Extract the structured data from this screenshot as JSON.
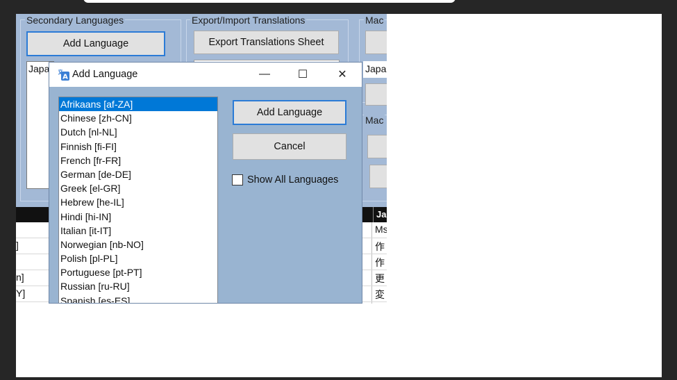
{
  "app": {
    "secondary_languages": {
      "label": "Secondary Languages",
      "add_button": "Add Language",
      "list_partial": "Japa"
    },
    "export_import": {
      "label": "Export/Import Translations",
      "export_button": "Export Translations Sheet"
    },
    "machine_group_1": {
      "label_partial": "Mac",
      "list_partial": "Japa"
    },
    "machine_group_2": {
      "label_partial": "Mac"
    },
    "grid": {
      "header_partial": "Ja",
      "rows": [
        {
          "left": "",
          "right": "Ms"
        },
        {
          "left": "]",
          "right": "作"
        },
        {
          "left": "",
          "right": "作"
        },
        {
          "left": "n]",
          "right": "更"
        },
        {
          "left": "Y]",
          "right": "変"
        }
      ]
    }
  },
  "dialog": {
    "title": "Add Language",
    "icon": "translate-icon",
    "controls": {
      "minimize": "—",
      "maximize": "☐",
      "close": "✕"
    },
    "languages": [
      "Afrikaans [af-ZA]",
      "Chinese [zh-CN]",
      "Dutch [nl-NL]",
      "Finnish [fi-FI]",
      "French [fr-FR]",
      "German [de-DE]",
      "Greek [el-GR]",
      "Hebrew [he-IL]",
      "Hindi [hi-IN]",
      "Italian [it-IT]",
      "Norwegian [nb-NO]",
      "Polish [pl-PL]",
      "Portuguese [pt-PT]",
      "Russian [ru-RU]",
      "Spanish [es-ES]"
    ],
    "selected_language": "Afrikaans [af-ZA]",
    "add_button": "Add Language",
    "cancel_button": "Cancel",
    "show_all_label": "Show All Languages",
    "show_all_checked": false
  },
  "colors": {
    "app_background": "#a3b9d6",
    "dialog_background": "#99b4d1",
    "selection": "#0078d7",
    "focus_border": "#2b7bd6"
  }
}
